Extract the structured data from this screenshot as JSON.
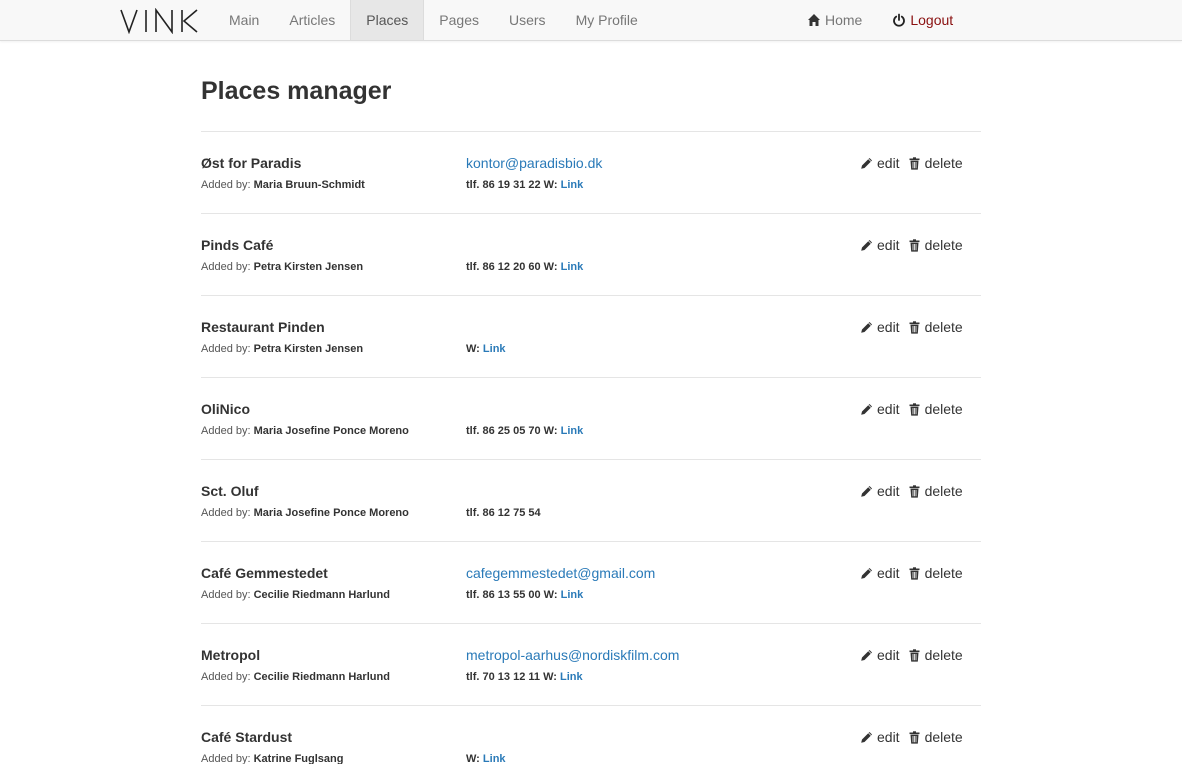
{
  "nav": {
    "brand": "VINK",
    "items": [
      {
        "label": "Main"
      },
      {
        "label": "Articles"
      },
      {
        "label": "Places",
        "active": true
      },
      {
        "label": "Pages"
      },
      {
        "label": "Users"
      },
      {
        "label": "My Profile"
      }
    ],
    "right": [
      {
        "label": "Home",
        "icon": "home-icon"
      },
      {
        "label": "Logout",
        "icon": "power-icon"
      }
    ]
  },
  "page": {
    "title": "Places manager",
    "added_by_label": "Added by:",
    "edit_label": "edit",
    "delete_label": "delete"
  },
  "places": [
    {
      "name": "Øst for Paradis",
      "added_by": "Maria Bruun-Schmidt",
      "email": "kontor@paradisbio.dk",
      "phone": "tlf. 86 19 31 22",
      "web": "W:",
      "link": "Link"
    },
    {
      "name": "Pinds Café",
      "added_by": "Petra Kirsten Jensen",
      "email": "",
      "phone": "tlf. 86 12 20 60",
      "web": "W:",
      "link": "Link"
    },
    {
      "name": "Restaurant Pinden",
      "added_by": "Petra Kirsten Jensen",
      "email": "",
      "phone": "",
      "web": "W:",
      "link": "Link"
    },
    {
      "name": "OliNico",
      "added_by": "Maria Josefine Ponce Moreno",
      "email": "",
      "phone": "tlf. 86 25 05 70",
      "web": "W:",
      "link": "Link"
    },
    {
      "name": "Sct. Oluf",
      "added_by": "Maria Josefine Ponce Moreno",
      "email": "",
      "phone": "tlf. 86 12 75 54",
      "web": "",
      "link": ""
    },
    {
      "name": "Café Gemmestedet",
      "added_by": "Cecilie Riedmann Harlund",
      "email": "cafegemmestedet@gmail.com",
      "phone": "tlf. 86 13 55 00",
      "web": "W:",
      "link": "Link"
    },
    {
      "name": "Metropol",
      "added_by": "Cecilie Riedmann Harlund",
      "email": "metropol-aarhus@nordiskfilm.com",
      "phone": "tlf. 70 13 12 11",
      "web": "W:",
      "link": "Link"
    },
    {
      "name": "Café Stardust",
      "added_by": "Katrine Fuglsang",
      "email": "",
      "phone": "",
      "web": "W:",
      "link": "Link"
    }
  ],
  "colors": {
    "link": "#2a7ab8",
    "logout": "#8a1010",
    "nav_bg": "#f8f8f8"
  }
}
